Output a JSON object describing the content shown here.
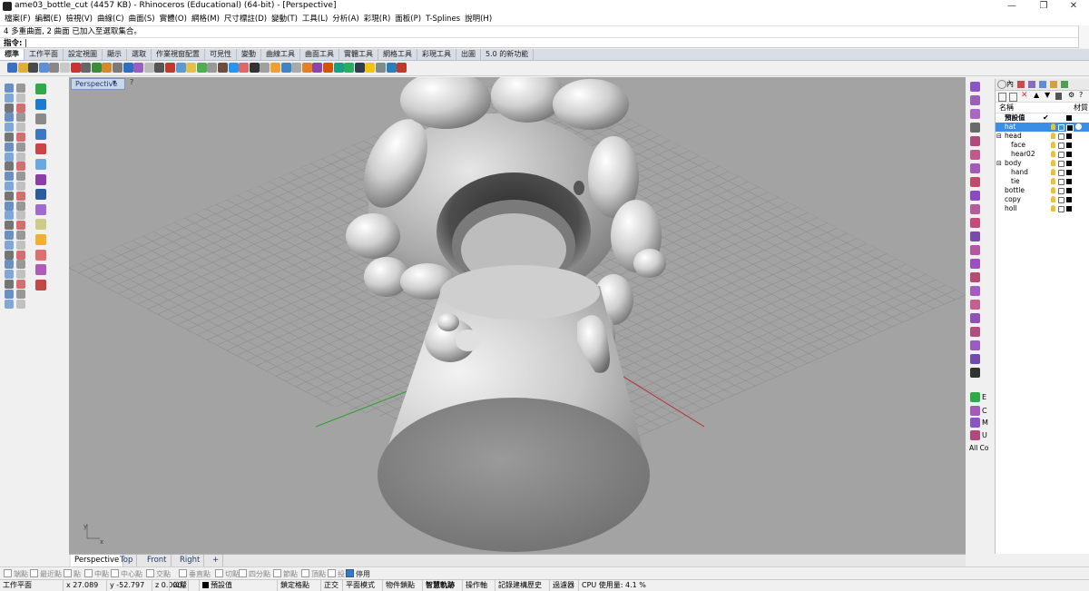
{
  "window": {
    "title": "ame03_bottle_cut (4457 KB) - Rhinoceros (Educational) (64-bit) - [Perspective]",
    "minimize": "—",
    "maximize": "❐",
    "close": "✕"
  },
  "menu": [
    "檔案(F)",
    "編輯(E)",
    "檢視(V)",
    "曲線(C)",
    "曲面(S)",
    "實體(O)",
    "網格(M)",
    "尺寸標註(D)",
    "變動(T)",
    "工具(L)",
    "分析(A)",
    "彩現(R)",
    "面板(P)",
    "T-Splines",
    "說明(H)"
  ],
  "command": {
    "history": "4 多重曲面, 2 曲面 已加入至選取集合。",
    "prompt": "指令:"
  },
  "toolbar_tabs": [
    "標準",
    "工作平面",
    "設定視圖",
    "顯示",
    "選取",
    "作業視窗配置",
    "可見性",
    "變動",
    "曲線工具",
    "曲面工具",
    "實體工具",
    "網格工具",
    "彩現工具",
    "出圖",
    "5.0 的新功能"
  ],
  "viewport": {
    "name": "Perspective",
    "dropdown": "▾",
    "help": "?",
    "axis_y": "y",
    "axis_x": "x"
  },
  "viewport_tabs": [
    "Perspective",
    "Top",
    "Front",
    "Right",
    "+"
  ],
  "osnaps": [
    {
      "label": "端點",
      "on": false
    },
    {
      "label": "最近點",
      "on": false
    },
    {
      "label": "點",
      "on": false
    },
    {
      "label": "中點",
      "on": false
    },
    {
      "label": "中心點",
      "on": false
    },
    {
      "label": "交點",
      "on": false
    },
    {
      "label": "垂直點",
      "on": false
    },
    {
      "label": "切點",
      "on": false
    },
    {
      "label": "四分點",
      "on": false
    },
    {
      "label": "節點",
      "on": false
    },
    {
      "label": "頂點",
      "on": false
    },
    {
      "label": "投影",
      "on": false
    },
    {
      "label": "停用",
      "on": true
    }
  ],
  "status": {
    "cplane": "工作平面",
    "x": "x 27.089",
    "y": "y -52.797",
    "z": "z 0.000",
    "units": "公釐",
    "layer": "預設值",
    "grid_snap": "鎖定格點",
    "ortho": "正交",
    "planar": "平面模式",
    "osnap": "物件鎖點",
    "smarttrack": "智慧軌跡",
    "gumball": "操作軸",
    "history": "記錄建構歷史",
    "filter": "過濾器",
    "cpu": "CPU 使用量: 4.1 %"
  },
  "side_labels": [
    "E",
    "C",
    "M",
    "U",
    "All Co"
  ],
  "layers_panel": {
    "tab_label": "內",
    "column_name": "名稱",
    "column_material": "材質",
    "layers": [
      {
        "name": "預設值",
        "indent": 0,
        "bold": true,
        "current": true,
        "selected": false,
        "color": "#000000"
      },
      {
        "name": "hat",
        "indent": 0,
        "bold": false,
        "current": false,
        "selected": true,
        "color": "#000000"
      },
      {
        "name": "head",
        "indent": 0,
        "bold": false,
        "current": false,
        "selected": false,
        "color": "#000000",
        "expander": "⊟"
      },
      {
        "name": "face",
        "indent": 1,
        "bold": false,
        "current": false,
        "selected": false,
        "color": "#000000"
      },
      {
        "name": "hear02",
        "indent": 1,
        "bold": false,
        "current": false,
        "selected": false,
        "color": "#000000"
      },
      {
        "name": "body",
        "indent": 0,
        "bold": false,
        "current": false,
        "selected": false,
        "color": "#000000",
        "expander": "⊟"
      },
      {
        "name": "hand",
        "indent": 1,
        "bold": false,
        "current": false,
        "selected": false,
        "color": "#000000"
      },
      {
        "name": "tie",
        "indent": 1,
        "bold": false,
        "current": false,
        "selected": false,
        "color": "#000000"
      },
      {
        "name": "bottle",
        "indent": 0,
        "bold": false,
        "current": false,
        "selected": false,
        "color": "#000000"
      },
      {
        "name": "copy",
        "indent": 0,
        "bold": false,
        "current": false,
        "selected": false,
        "color": "#000000"
      },
      {
        "name": "holl",
        "indent": 0,
        "bold": false,
        "current": false,
        "selected": false,
        "color": "#000000"
      }
    ]
  },
  "colors": {
    "viewport_bg": "#a3a3a3",
    "grid": "#8f8f8f",
    "x_axis": "#b03030",
    "y_axis": "#30a030",
    "selected_layer": "#3a8ee6"
  }
}
